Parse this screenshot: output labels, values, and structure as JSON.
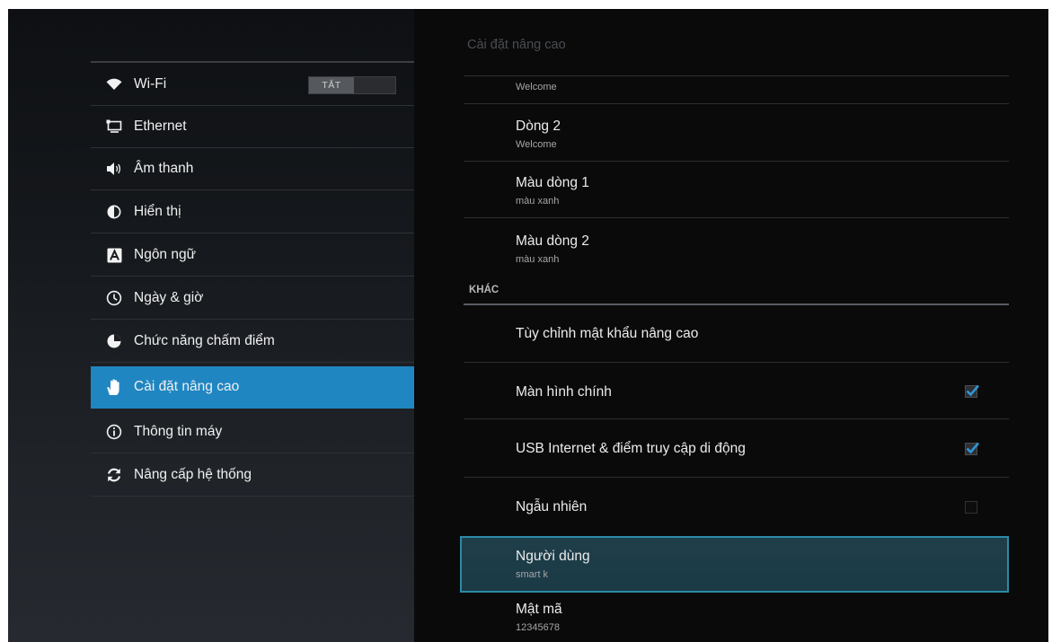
{
  "nav": {
    "items": [
      {
        "label": "Wi-Fi",
        "icon": "wifi-icon"
      },
      {
        "label": "Ethernet",
        "icon": "ethernet-icon"
      },
      {
        "label": "Âm thanh",
        "icon": "volume-icon"
      },
      {
        "label": "Hiển thị",
        "icon": "brightness-icon"
      },
      {
        "label": "Ngôn ngữ",
        "icon": "language-icon"
      },
      {
        "label": "Ngày & giờ",
        "icon": "clock-icon"
      },
      {
        "label": "Chức năng chấm điểm",
        "icon": "pie-icon"
      },
      {
        "label": "Cài đặt nâng cao",
        "icon": "hand-icon",
        "selected": true
      },
      {
        "label": "Thông tin máy",
        "icon": "info-icon"
      },
      {
        "label": "Nâng cấp hệ thống",
        "icon": "refresh-icon"
      }
    ],
    "wifi_toggle": "TẮT"
  },
  "right": {
    "title": "Cài đặt nâng cao",
    "rows": [
      {
        "subtitle": "Welcome"
      },
      {
        "title": "Dòng 2",
        "subtitle": "Welcome"
      },
      {
        "title": "Màu dòng 1",
        "subtitle": "màu xanh"
      },
      {
        "title": "Màu dòng 2",
        "subtitle": "màu xanh"
      }
    ],
    "section": "KHÁC",
    "options": [
      {
        "title": "Tùy chỉnh mật khẩu nâng cao"
      },
      {
        "title": "Màn hình chính",
        "checked": true
      },
      {
        "title": "USB Internet & điểm truy cập di động",
        "checked": true
      },
      {
        "title": "Ngẫu nhiên",
        "checked": false
      },
      {
        "title": "Người dùng",
        "subtitle": "smart k"
      },
      {
        "title": "Mật mã",
        "subtitle": "12345678"
      }
    ]
  },
  "colors": {
    "accent": "#1f86c2",
    "focus_border": "#2b8aa6",
    "check": "#2f95d6"
  }
}
